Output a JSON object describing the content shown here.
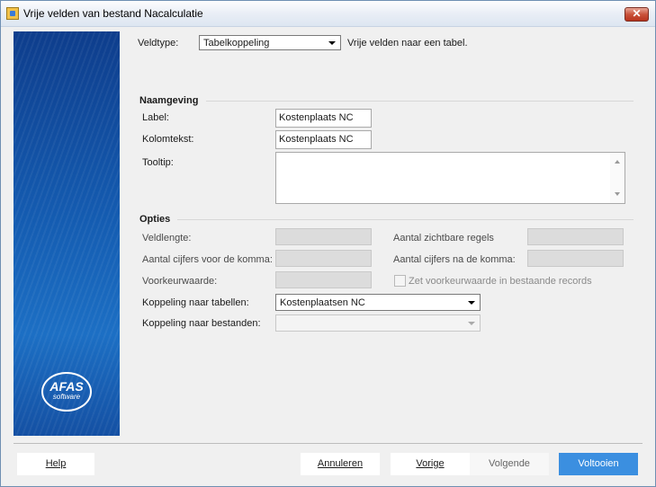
{
  "window": {
    "title": "Vrije velden van bestand Nacalculatie",
    "close_label": "✕"
  },
  "sidebar": {
    "watermark": "AFAS",
    "logo_line1": "AFAS",
    "logo_line2": "software"
  },
  "veldtype": {
    "label": "Veldtype:",
    "value": "Tabelkoppeling",
    "description": "Vrije velden naar een tabel."
  },
  "naamgeving": {
    "title": "Naamgeving",
    "label_label": "Label:",
    "label_value": "Kostenplaats NC",
    "kolomtekst_label": "Kolomtekst:",
    "kolomtekst_value": "Kostenplaats NC",
    "tooltip_label": "Tooltip:",
    "tooltip_value": ""
  },
  "opties": {
    "title": "Opties",
    "veldlengte": "Veldlengte:",
    "aantal_zichtbare_regels": "Aantal zichtbare regels",
    "cijfers_voor": "Aantal cijfers voor de komma:",
    "cijfers_na": "Aantal cijfers na de komma:",
    "voorkeurwaarde": "Voorkeurwaarde:",
    "zet_voorkeurwaarde": "Zet voorkeurwaarde in bestaande records",
    "koppeling_tabellen_label": "Koppeling naar tabellen:",
    "koppeling_tabellen_value": "Kostenplaatsen NC",
    "koppeling_bestanden_label": "Koppeling naar bestanden:",
    "koppeling_bestanden_value": ""
  },
  "buttons": {
    "help": "Help",
    "annuleren": "Annuleren",
    "vorige": "Vorige",
    "volgende": "Volgende",
    "voltooien": "Voltooien"
  }
}
